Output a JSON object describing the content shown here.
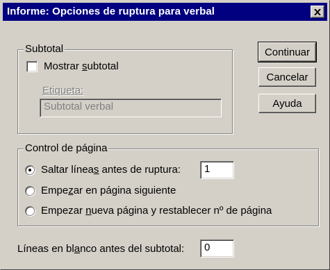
{
  "window": {
    "title": "Informe: Opciones de ruptura para verbal"
  },
  "subtotal_group": {
    "label": "Subtotal",
    "show_subtotal": {
      "label_pre": "Mostrar ",
      "label_u": "s",
      "label_post": "ubtotal",
      "checked": false
    },
    "etiqueta_label": "Etiqueta:",
    "etiqueta_value": "Subtotal verbal"
  },
  "buttons": {
    "continuar": "Continuar",
    "cancelar": "Cancelar",
    "ayuda": "Ayuda"
  },
  "page_control_group": {
    "label": "Control de página",
    "options": [
      {
        "label_pre": "Saltar línea",
        "label_u": "s",
        "label_post": " antes de ruptura:",
        "checked": true
      },
      {
        "label_pre": "Empe",
        "label_u": "z",
        "label_post": "ar en página siguiente",
        "checked": false
      },
      {
        "label_pre": "Empezar ",
        "label_u": "n",
        "label_post": "ueva página y restablecer nº de página",
        "checked": false
      }
    ],
    "skip_lines_value": "1"
  },
  "blank_lines": {
    "label_pre": "Líneas en bl",
    "label_u": "a",
    "label_post": "nco antes del subtotal:",
    "value": "0"
  }
}
